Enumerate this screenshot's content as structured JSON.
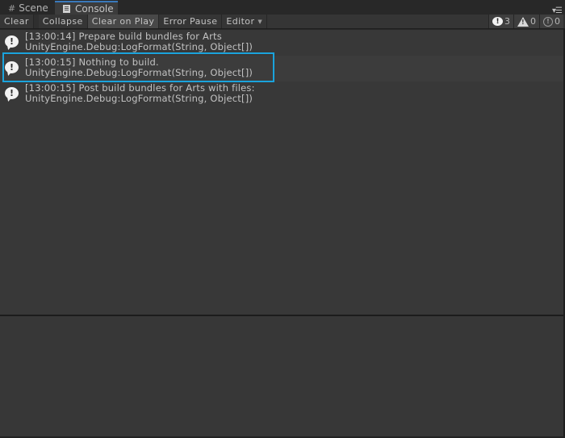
{
  "tabs": [
    {
      "label": "Scene",
      "icon": "grid-icon",
      "active": false
    },
    {
      "label": "Console",
      "icon": "console-icon",
      "active": true
    }
  ],
  "toolbar": {
    "clear_label": "Clear",
    "collapse_label": "Collapse",
    "clear_on_play_label": "Clear on Play",
    "error_pause_label": "Error Pause",
    "editor_label": "Editor",
    "info_count": "3",
    "warning_count": "0",
    "error_count": "0"
  },
  "logs": [
    {
      "type": "info",
      "message": "[13:00:14] Prepare build bundles for Arts",
      "stack": "UnityEngine.Debug:LogFormat(String, Object[])"
    },
    {
      "type": "info",
      "message": "[13:00:15] Nothing to build.",
      "stack": "UnityEngine.Debug:LogFormat(String, Object[])",
      "highlighted": true
    },
    {
      "type": "info",
      "message": "[13:00:15] Post build bundles for Arts with files:",
      "stack": "UnityEngine.Debug:LogFormat(String, Object[])"
    }
  ],
  "colors": {
    "tab_accent": "#3a79bb",
    "highlight_border": "#1aa3dc"
  }
}
